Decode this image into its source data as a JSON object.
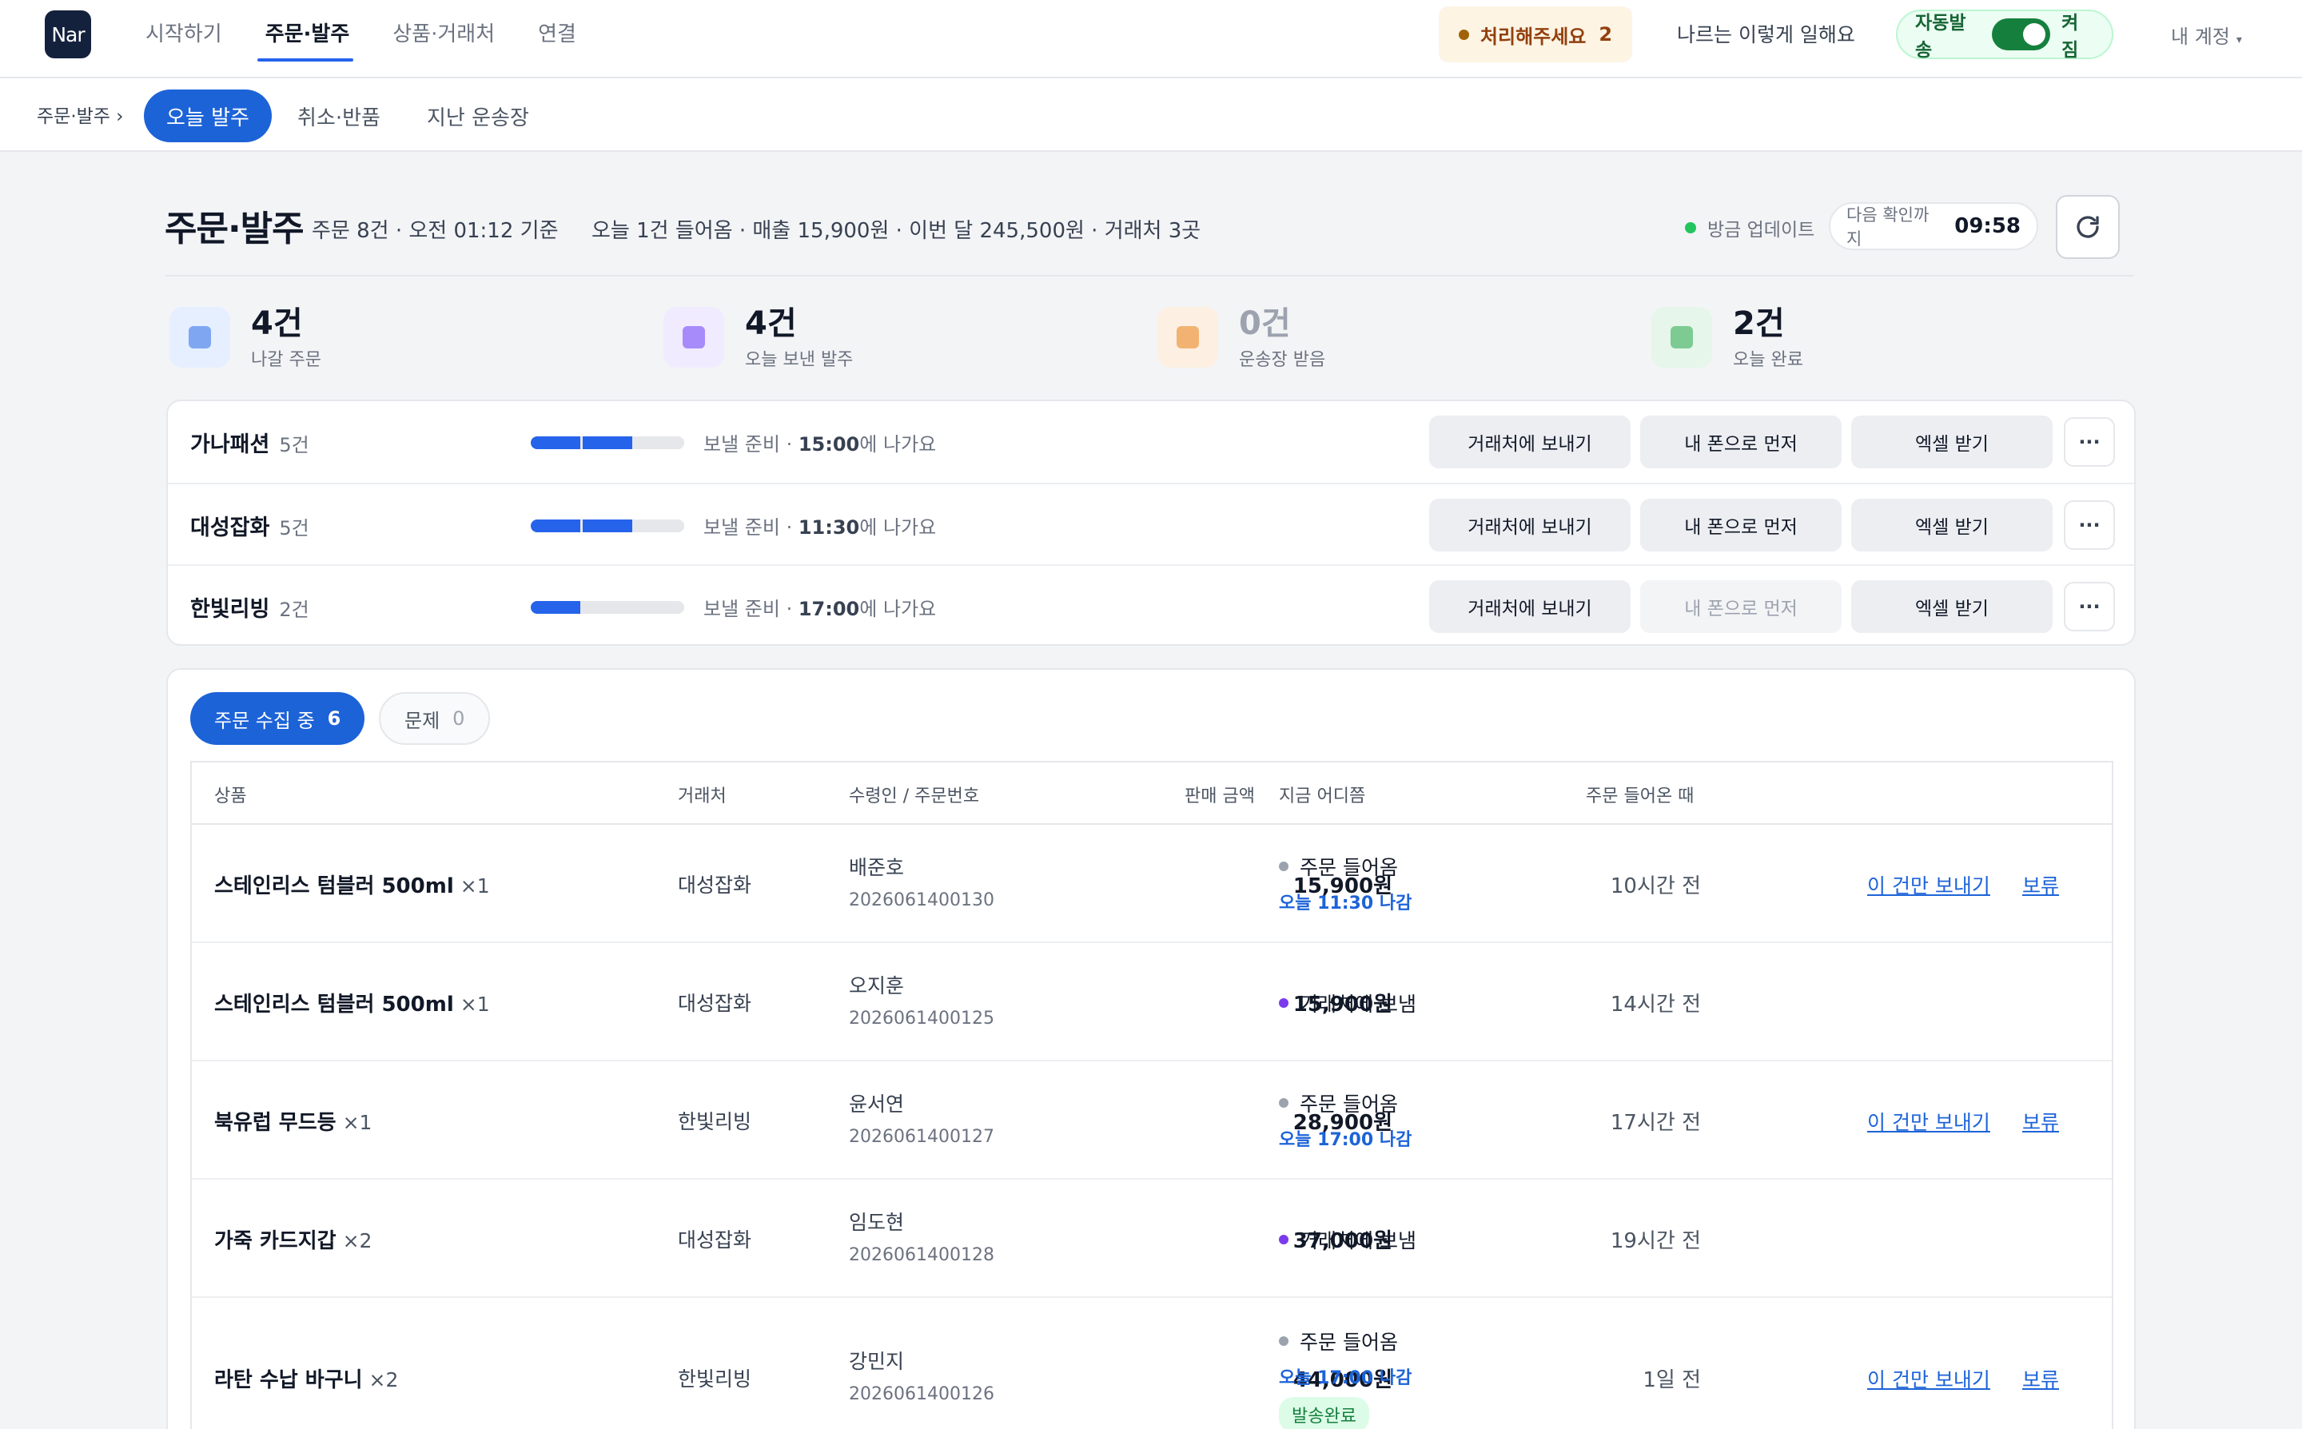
{
  "app": {
    "logo": "Nar"
  },
  "topnav": [
    {
      "label": "시작하기"
    },
    {
      "label": "주문·발주"
    },
    {
      "label": "상품·거래처"
    },
    {
      "label": "연결"
    }
  ],
  "alert": {
    "label": "처리해주세요",
    "count": "2",
    "color": "#a16207"
  },
  "how_link": "나르는 이렇게 일해요",
  "auto_ship": {
    "label": "자동발송",
    "state": "켜짐",
    "on": true
  },
  "account": {
    "label": "내 계정",
    "caret": "▾"
  },
  "breadcrumb": "주문·발주 ›",
  "subtabs": [
    {
      "label": "오늘 발주"
    },
    {
      "label": "취소·반품"
    },
    {
      "label": "지난 운송장"
    }
  ],
  "header": {
    "title": "주문·발주",
    "meta": "주문 8건 · 오전 01:12 기준",
    "stats": "오늘 1건 들어옴 · 매출 15,900원 · 이번 달 245,500원 · 거래처 3곳",
    "updated": "방금 업데이트",
    "next_label": "다음 확인까지",
    "next_time": "09:58",
    "refresh_icon": "refresh-icon"
  },
  "summary": [
    {
      "value": "4건",
      "label": "나갈 주문",
      "bg": "#e6efff",
      "fg": "#7fa7f1"
    },
    {
      "value": "4건",
      "label": "오늘 보낸 발주",
      "bg": "#f1ebff",
      "fg": "#a78bfa"
    },
    {
      "value": "0건",
      "label": "운송장 받음",
      "bg": "#fdf0e2",
      "fg": "#f2b372",
      "muted": true
    },
    {
      "value": "2건",
      "label": "오늘 완료",
      "bg": "#e6f6ea",
      "fg": "#7dcb92"
    }
  ],
  "vendors": [
    {
      "name": "가나패션",
      "count": "5건",
      "progress": 0.67,
      "status_prefix": "보낼 준비 · ",
      "time": "15:00",
      "status_suffix": "에 나가요",
      "send": "거래처에 보내기",
      "phone": "내 폰으로 먼저",
      "phone_enabled": true,
      "excel": "엑셀 받기",
      "more": "···"
    },
    {
      "name": "대성잡화",
      "count": "5건",
      "progress": 0.67,
      "status_prefix": "보낼 준비 · ",
      "time": "11:30",
      "status_suffix": "에 나가요",
      "send": "거래처에 보내기",
      "phone": "내 폰으로 먼저",
      "phone_enabled": true,
      "excel": "엑셀 받기",
      "more": "···"
    },
    {
      "name": "한빛리빙",
      "count": "2건",
      "progress": 0.33,
      "status_prefix": "보낼 준비 · ",
      "time": "17:00",
      "status_suffix": "에 나가요",
      "send": "거래처에 보내기",
      "phone": "내 폰으로 먼저",
      "phone_enabled": false,
      "excel": "엑셀 받기",
      "more": "···"
    }
  ],
  "order_tabs": [
    {
      "label": "주문 수집 중",
      "count": "6"
    },
    {
      "label": "문제",
      "count": "0"
    }
  ],
  "table": {
    "columns": [
      "상품",
      "거래처",
      "수령인 / 주문번호",
      "판매 금액",
      "지금 어디쯤",
      "주문 들어온 때"
    ],
    "rows": [
      {
        "product": "스테인리스 텀블러 500ml",
        "qty": "×1",
        "vendor": "대성잡화",
        "recipient": "배준호",
        "order_no": "2026061400130",
        "amount": "15,900원",
        "status": "주문 들어옴",
        "status_color": "#9ca3af",
        "eta": "오늘 11:30 나감",
        "badge": "",
        "ago": "10시간 전",
        "action": "이 건만 보내기",
        "hold": "보류"
      },
      {
        "product": "스테인리스 텀블러 500ml",
        "qty": "×1",
        "vendor": "대성잡화",
        "recipient": "오지훈",
        "order_no": "2026061400125",
        "amount": "15,900원",
        "status": "거래처에 보냄",
        "status_color": "#7c3aed",
        "eta": "",
        "badge": "",
        "ago": "14시간 전",
        "action": "",
        "hold": ""
      },
      {
        "product": "북유럽 무드등",
        "qty": "×1",
        "vendor": "한빛리빙",
        "recipient": "윤서연",
        "order_no": "2026061400127",
        "amount": "28,900원",
        "status": "주문 들어옴",
        "status_color": "#9ca3af",
        "eta": "오늘 17:00 나감",
        "badge": "",
        "ago": "17시간 전",
        "action": "이 건만 보내기",
        "hold": "보류"
      },
      {
        "product": "가죽 카드지갑",
        "qty": "×2",
        "vendor": "대성잡화",
        "recipient": "임도현",
        "order_no": "2026061400128",
        "amount": "37,000원",
        "status": "거래처에 보냄",
        "status_color": "#7c3aed",
        "eta": "",
        "badge": "",
        "ago": "19시간 전",
        "action": "",
        "hold": ""
      },
      {
        "product": "라탄 수납 바구니",
        "qty": "×2",
        "vendor": "한빛리빙",
        "recipient": "강민지",
        "order_no": "2026061400126",
        "amount": "44,000원",
        "status": "주문 들어옴",
        "status_color": "#9ca3af",
        "eta": "오늘 17:00 나감",
        "badge": "발송완료",
        "ago": "1일 전",
        "action": "이 건만 보내기",
        "hold": "보류"
      }
    ]
  },
  "colors": {
    "accent": "#1d63d8",
    "bar_fill": "#2563eb"
  }
}
